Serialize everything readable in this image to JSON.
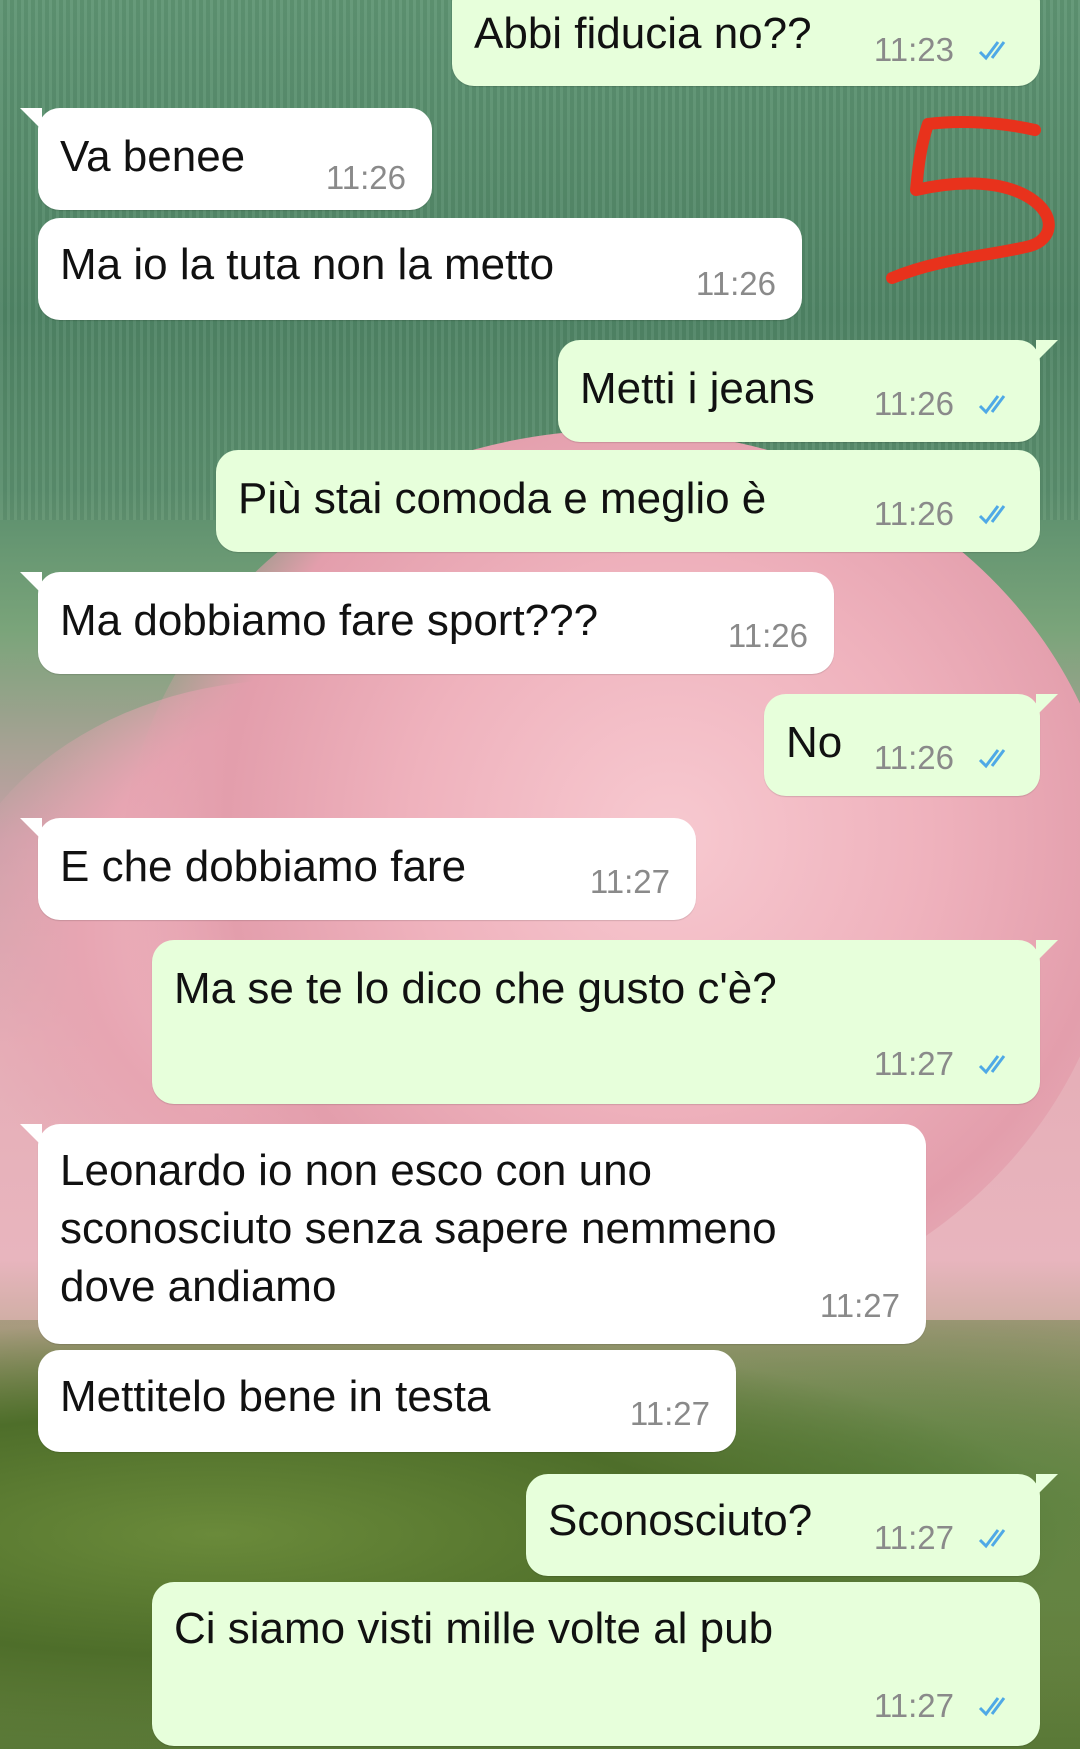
{
  "messages": [
    {
      "text": "Abbi fiducia no??",
      "time": "11:23"
    },
    {
      "text": "Va benee",
      "time": "11:26"
    },
    {
      "text": "Ma io la tuta non la metto",
      "time": "11:26"
    },
    {
      "text": "Metti i jeans",
      "time": "11:26"
    },
    {
      "text": "Più stai comoda e meglio è",
      "time": "11:26"
    },
    {
      "text": "Ma dobbiamo fare sport???",
      "time": "11:26"
    },
    {
      "text": "No",
      "time": "11:26"
    },
    {
      "text": "E che dobbiamo fare",
      "time": "11:27"
    },
    {
      "text": "Ma se te lo dico che gusto c'è?",
      "time": "11:27"
    },
    {
      "text": "Leonardo io non esco con uno\nsconosciuto senza sapere nemmeno\ndove andiamo",
      "time": "11:27"
    },
    {
      "text": "Mettitelo bene in testa",
      "time": "11:27"
    },
    {
      "text": "Sconosciuto?",
      "time": "11:27"
    },
    {
      "text": "Ci siamo visti mille volte al pub",
      "time": "11:27"
    }
  ],
  "colors": {
    "incoming_bubble": "#ffffff",
    "outgoing_bubble": "#e7ffdb",
    "read_ticks": "#4fa9e6",
    "annotation": "#e8321c"
  },
  "icons": {
    "read_receipt": "double-check-icon"
  }
}
